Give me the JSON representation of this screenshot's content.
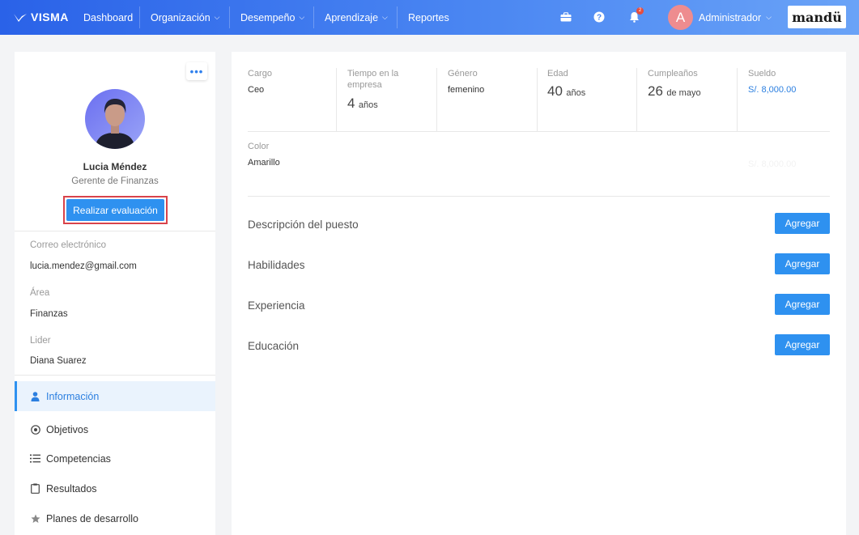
{
  "brand": {
    "logo_text": "VISMA",
    "partner_logo": "mandü"
  },
  "nav": {
    "items": [
      {
        "label": "Dashboard",
        "has_dropdown": false
      },
      {
        "label": "Organización",
        "has_dropdown": true
      },
      {
        "label": "Desempeño",
        "has_dropdown": true
      },
      {
        "label": "Aprendizaje",
        "has_dropdown": true
      },
      {
        "label": "Reportes",
        "has_dropdown": false
      }
    ],
    "icons": [
      "briefcase-icon",
      "help-icon",
      "bell-icon"
    ],
    "notification_count": "2",
    "user": {
      "initial": "A",
      "name": "Administrador"
    }
  },
  "profile": {
    "name": "Lucia Méndez",
    "role": "Gerente de Finanzas",
    "evaluate_label": "Realizar evaluación",
    "fields": [
      {
        "label": "Correo electrónico",
        "value": "lucia.mendez@gmail.com"
      },
      {
        "label": "Área",
        "value": "Finanzas"
      },
      {
        "label": "Lider",
        "value": "Diana Suarez"
      }
    ]
  },
  "menu": [
    {
      "label": "Información",
      "icon": "user-icon",
      "active": true
    },
    {
      "label": "Objetivos",
      "icon": "target-icon",
      "active": false
    },
    {
      "label": "Competencias",
      "icon": "list-icon",
      "active": false
    },
    {
      "label": "Resultados",
      "icon": "clipboard-icon",
      "active": false
    },
    {
      "label": "Planes de desarrollo",
      "icon": "star-icon",
      "active": false
    }
  ],
  "info": {
    "cargo": {
      "label": "Cargo",
      "value": "Ceo"
    },
    "tiempo": {
      "label": "Tiempo en la empresa",
      "number": "4",
      "unit": "años"
    },
    "genero": {
      "label": "Género",
      "value": "femenino"
    },
    "edad": {
      "label": "Edad",
      "number": "40",
      "unit": "años"
    },
    "cumple": {
      "label": "Cumpleaños",
      "number": "26",
      "unit": "de mayo"
    },
    "sueldo": {
      "label": "Sueldo",
      "value": "S/. 8,000.00"
    },
    "color": {
      "label": "Color",
      "value": "Amarillo"
    },
    "ghost_value": "S/. 8,000.00"
  },
  "sections": [
    {
      "title": "Descripción del puesto",
      "button": "Agregar"
    },
    {
      "title": "Habilidades",
      "button": "Agregar"
    },
    {
      "title": "Experiencia",
      "button": "Agregar"
    },
    {
      "title": "Educación",
      "button": "Agregar"
    }
  ],
  "colors": {
    "primary": "#2e91f0",
    "nav_gradient_start": "#2a62e8",
    "nav_gradient_end": "#6aa3f7",
    "highlight": "#d9434b"
  }
}
